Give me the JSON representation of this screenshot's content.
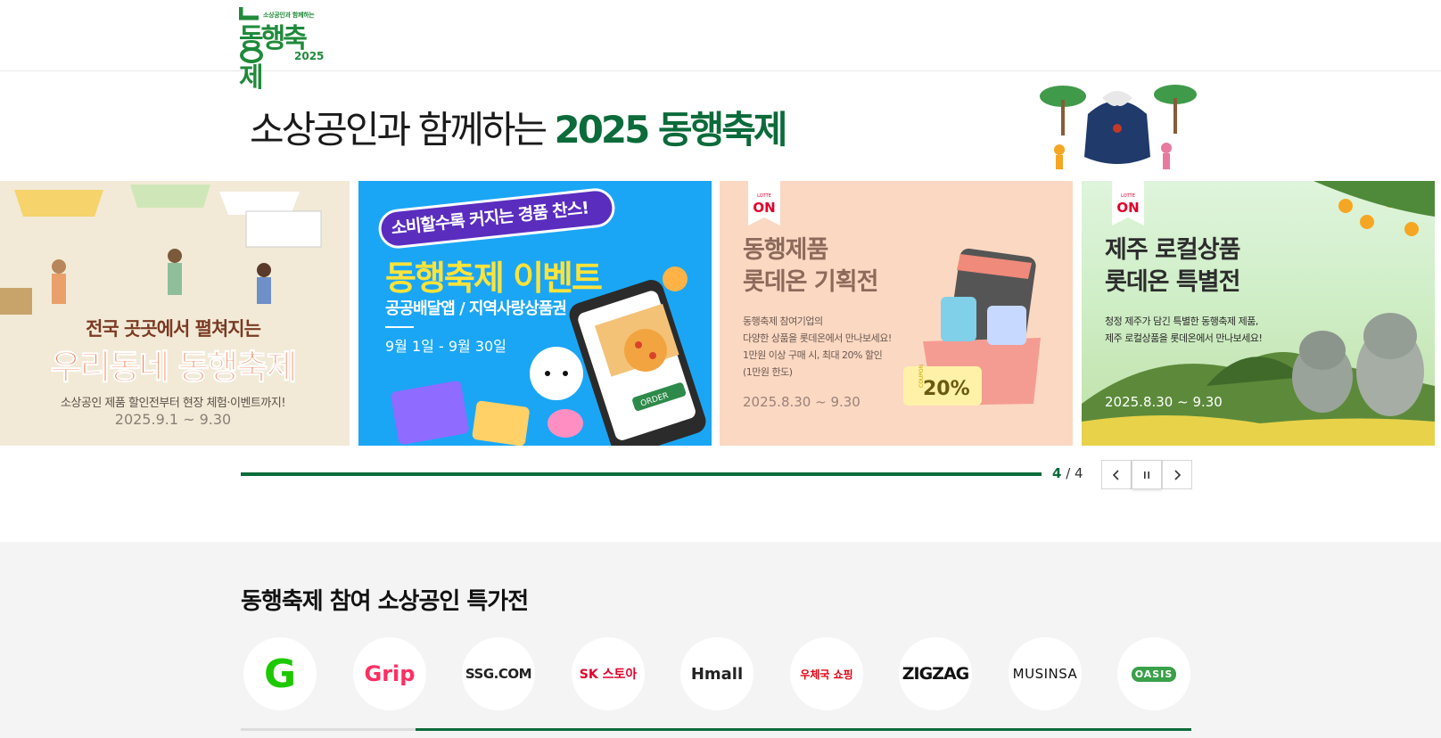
{
  "header": {
    "logo_small": "소상공인과 함께하는",
    "logo_big": "동행축제",
    "logo_year": "2025"
  },
  "hero": {
    "title_plain": "소상공인과 함께하는 ",
    "title_accent": "2025 동행축제"
  },
  "banners": [
    {
      "line1": "전국 곳곳에서 펼쳐지는",
      "line2": "우리동네 동행축제",
      "line3": "소상공인 제품 할인전부터 현장 체험·이벤트까지!",
      "date": "2025.9.1 ~ 9.30"
    },
    {
      "pill": "소비할수록 커지는 경품 찬스!",
      "line1": "동행축제 이벤트",
      "line2": "공공배달앱 / 지역사랑상품권",
      "date": "9월 1일 - 9월 30일",
      "order_label": "ORDER"
    },
    {
      "badge_small": "LOTTE",
      "badge": "ON",
      "title": "동행제품\n롯데온 기획전",
      "desc": "동행축제 참여기업의\n다양한 상품을 롯데온에서 만나보세요!\n1만원 이상 구매 시, 최대 20% 할인\n(1만원 한도)",
      "date": "2025.8.30 ~ 9.30",
      "coupon": "20%",
      "coupon_side": "COUPON"
    },
    {
      "badge_small": "LOTTE",
      "badge": "ON",
      "title": "제주 로컬상품\n롯데온 특별전",
      "desc": "청정 제주가 담긴 특별한 동행축제 제품,\n제주 로컬상품을 롯데온에서 만나보세요!",
      "date": "2025.8.30 ~ 9.30"
    }
  ],
  "pager": {
    "current": "4",
    "total": " / 4",
    "progress_fraction": 1.0,
    "prev_icon": "chevron-left-icon",
    "pause_icon": "pause-icon",
    "next_icon": "chevron-right-icon"
  },
  "special": {
    "title": "동행축제 참여 소상공인 특가전",
    "partners": [
      {
        "label": "G",
        "icon": "gmarket-logo"
      },
      {
        "label": "Grip",
        "icon": "grip-logo"
      },
      {
        "label": "SSG.COM",
        "icon": "ssg-logo"
      },
      {
        "label": "SK 스토아",
        "icon": "sk-stoa-logo"
      },
      {
        "label": "Hmall",
        "icon": "hmall-logo"
      },
      {
        "label": "우체국 쇼핑",
        "icon": "epost-logo"
      },
      {
        "label": "ZIGZAG",
        "icon": "zigzag-logo"
      },
      {
        "label": "MUSINSA",
        "icon": "musinsa-logo"
      },
      {
        "label": "OASIS",
        "icon": "oasis-logo"
      }
    ]
  },
  "colors": {
    "brand_green": "#0b6b3a",
    "logo_green": "#1f8a3a",
    "section_bg": "#f4f4f4"
  }
}
